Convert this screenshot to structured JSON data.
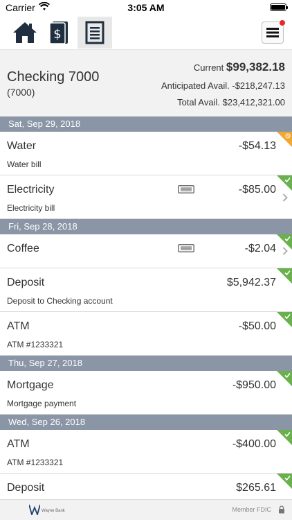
{
  "status_bar": {
    "carrier": "Carrier",
    "time": "3:05 AM"
  },
  "nav": {
    "tabs": [
      "home-icon",
      "money-icon",
      "statement-icon"
    ],
    "active_tab": "statement"
  },
  "account": {
    "name": "Checking 7000",
    "number": "(7000)",
    "current_label": "Current",
    "current_amount": "$99,382.18",
    "anticipated_label": "Anticipated Avail.",
    "anticipated_amount": "-$218,247.13",
    "total_label": "Total Avail.",
    "total_amount": "$23,412,321.00"
  },
  "groups": [
    {
      "date": "Sat, Sep 29, 2018",
      "transactions": [
        {
          "title": "Water",
          "amount": "-$54.13",
          "desc": "Water bill",
          "status": "pending",
          "receipt": false,
          "chevron": false
        },
        {
          "title": "Electricity",
          "amount": "-$85.00",
          "desc": "Electricity bill",
          "status": "cleared",
          "receipt": true,
          "chevron": true
        }
      ]
    },
    {
      "date": "Fri, Sep 28, 2018",
      "transactions": [
        {
          "title": "Coffee",
          "amount": "-$2.04",
          "desc": "",
          "status": "cleared",
          "receipt": true,
          "chevron": true
        },
        {
          "title": "Deposit",
          "amount": "$5,942.37",
          "desc": "Deposit to Checking account",
          "status": "cleared",
          "receipt": false,
          "chevron": false
        },
        {
          "title": "ATM",
          "amount": "-$50.00",
          "desc": "ATM #1233321",
          "status": "cleared",
          "receipt": false,
          "chevron": false
        }
      ]
    },
    {
      "date": "Thu, Sep 27, 2018",
      "transactions": [
        {
          "title": "Mortgage",
          "amount": "-$950.00",
          "desc": "Mortgage payment",
          "status": "cleared",
          "receipt": false,
          "chevron": false
        }
      ]
    },
    {
      "date": "Wed, Sep 26, 2018",
      "transactions": [
        {
          "title": "ATM",
          "amount": "-$400.00",
          "desc": "ATM #1233321",
          "status": "cleared",
          "receipt": false,
          "chevron": false
        },
        {
          "title": "Deposit",
          "amount": "$265.61",
          "desc": "",
          "status": "cleared",
          "receipt": false,
          "chevron": false
        }
      ]
    }
  ],
  "footer": {
    "bank_name": "Wayne Bank",
    "fdic": "Member FDIC"
  },
  "colors": {
    "date_header": "#8a96a6",
    "cleared": "#6ab04c",
    "pending": "#f0a830",
    "badge": "#e8262b",
    "icon_dark": "#1f2f3f"
  }
}
